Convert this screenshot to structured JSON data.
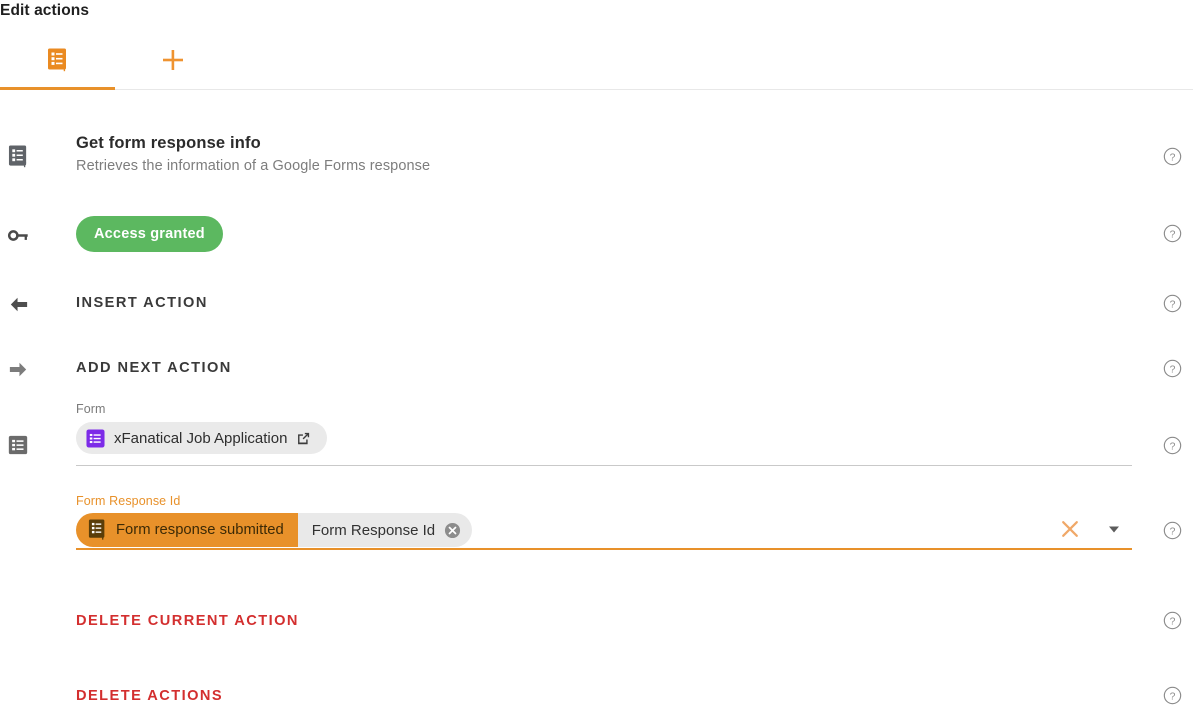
{
  "window": {
    "title": "Edit actions"
  },
  "tabs": [
    {
      "name": "forms-action-tab",
      "icon": "google-forms-icon",
      "label": "",
      "active": true
    },
    {
      "name": "add-tab",
      "icon": "plus-icon",
      "label": "",
      "active": false
    }
  ],
  "action": {
    "icon": "google-forms-grey-icon",
    "title": "Get form response info",
    "subtitle": "Retrieves the information of a Google Forms response"
  },
  "auth": {
    "icon": "key-icon",
    "status_label": "Access granted",
    "status_color": "#5cb860"
  },
  "nav_actions": [
    {
      "name": "insert-action",
      "icon": "arrow-left-icon",
      "label": "INSERT ACTION"
    },
    {
      "name": "add-next-action",
      "icon": "arrow-right-icon",
      "label": "ADD NEXT ACTION"
    }
  ],
  "fields": {
    "form": {
      "icon": "list-grey-icon",
      "label": "Form",
      "chip": {
        "icon": "google-sheets-purple-icon",
        "text": "xFanatical Job Application",
        "open_icon": "external-link-icon"
      }
    },
    "form_response_id": {
      "label": "Form Response Id",
      "label_color": "#e8912a",
      "focused": true,
      "token_source": {
        "icon": "google-forms-icon",
        "text": "Form response submitted",
        "bg_color": "#e8912a"
      },
      "token_value": {
        "text": "Form Response Id",
        "remove_icon": "chip-remove-icon"
      },
      "clear_icon": "clear-x-icon",
      "dropdown_icon": "chevron-down-icon"
    }
  },
  "delete_actions": [
    {
      "name": "delete-current-action",
      "label": "DELETE CURRENT ACTION"
    },
    {
      "name": "delete-actions",
      "label": "DELETE ACTIONS"
    }
  ],
  "help_icon": "help-circle-icon"
}
